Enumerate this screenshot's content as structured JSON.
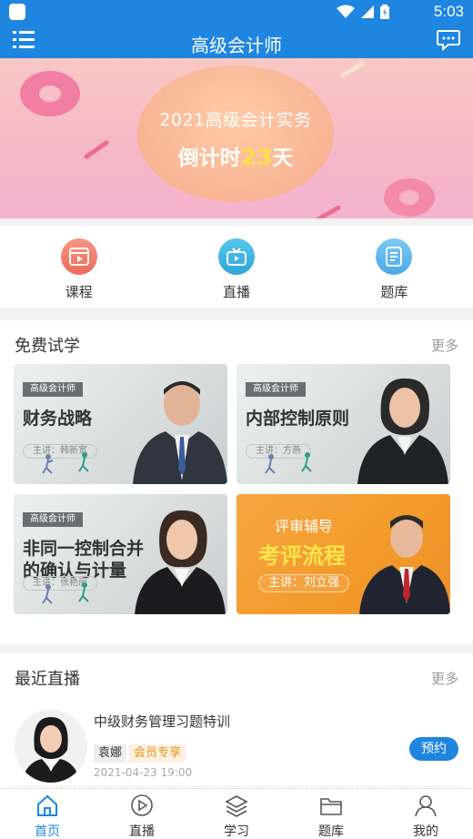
{
  "status_bar": {
    "time": "5:03"
  },
  "title_bar": {
    "title": "高级会计师"
  },
  "banner": {
    "line1": "2021高级会计实务",
    "countdown_prefix": "倒计时",
    "countdown_days": "23",
    "countdown_suffix": "天"
  },
  "quick_nav": [
    {
      "label": "课程",
      "icon": "course-icon",
      "color": "#f27d6a"
    },
    {
      "label": "直播",
      "icon": "tv-icon",
      "color": "#3db6e3"
    },
    {
      "label": "题库",
      "icon": "question-bank-icon",
      "color": "#59b8ef"
    }
  ],
  "free_trial": {
    "heading": "免费试学",
    "more": "更多",
    "cards": [
      {
        "tag": "高级会计师",
        "title": "财务战略",
        "lecturer": "主讲：韩新宽"
      },
      {
        "tag": "高级会计师",
        "title": "内部控制原则",
        "lecturer": "主讲：方燕"
      },
      {
        "tag": "高级会计师",
        "title_line1": "非同一控制合并",
        "title_line2": "的确认与计量",
        "lecturer": "主讲：张艳丽"
      },
      {
        "subtitle": "评审辅导",
        "title": "考评流程",
        "lecturer": "主讲：刘立强"
      }
    ]
  },
  "recent_live": {
    "heading": "最近直播",
    "more": "更多",
    "item": {
      "title": "中级财务管理习题特训",
      "teacher": "袁娜",
      "badge": "会员专享",
      "date": "2021-04-23 19:00",
      "action": "预约"
    }
  },
  "tab_bar": [
    {
      "label": "首页",
      "icon": "home-icon",
      "active": true
    },
    {
      "label": "直播",
      "icon": "play-icon",
      "active": false
    },
    {
      "label": "学习",
      "icon": "layers-icon",
      "active": false
    },
    {
      "label": "题库",
      "icon": "folder-icon",
      "active": false
    },
    {
      "label": "我的",
      "icon": "user-icon",
      "active": false
    }
  ],
  "colors": {
    "primary": "#1f86e0",
    "accent_orange": "#f29a2a",
    "vip_orange": "#e6951f"
  }
}
